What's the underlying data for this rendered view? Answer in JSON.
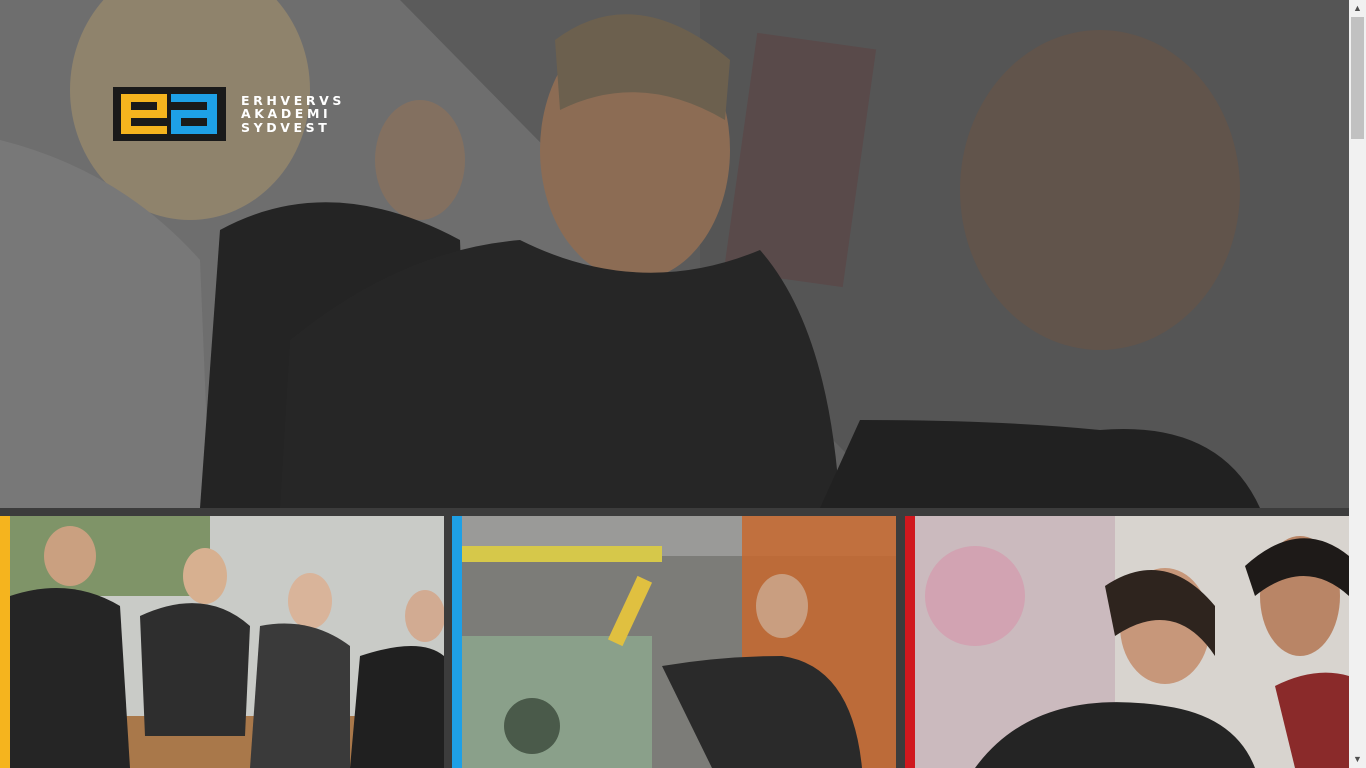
{
  "brand": {
    "name_lines": [
      "ERHVERVS",
      "AKADEMI",
      "SYDVEST"
    ],
    "logo_mark": "ea",
    "colors": {
      "yellow": "#f5b41e",
      "blue": "#1ea0e6",
      "red": "#d0181e",
      "dark": "#1a1a1a"
    }
  },
  "hero": {
    "image": "students-talking-photo"
  },
  "cards": [
    {
      "accent": "#f5b41e",
      "image": "students-sitting-photo"
    },
    {
      "accent": "#1ea0e6",
      "image": "machine-workshop-photo"
    },
    {
      "accent": "#d0181e",
      "image": "students-at-computer-photo"
    }
  ],
  "scrollbar": {
    "up_icon": "▲",
    "down_icon": "▼"
  }
}
